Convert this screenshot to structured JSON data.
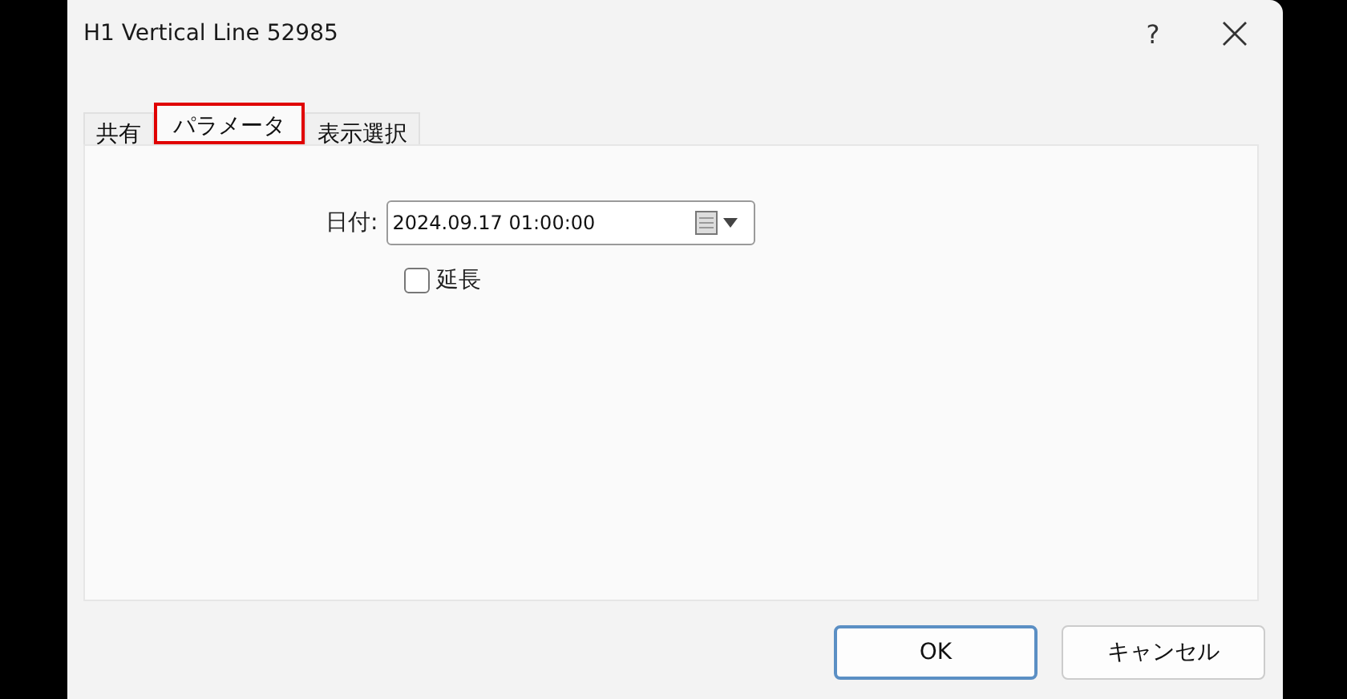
{
  "window": {
    "title": "H1 Vertical Line 52985",
    "help": "?"
  },
  "tabs": [
    {
      "label": "共有",
      "selected": false
    },
    {
      "label": "パラメータ",
      "selected": true
    },
    {
      "label": "表示選択",
      "selected": false
    }
  ],
  "date_field": {
    "label": "日付:",
    "value": "2024.09.17 01:00:00"
  },
  "extend_checkbox": {
    "label": "延長",
    "checked": false
  },
  "buttons": [
    {
      "label": "OK",
      "kind": "default"
    },
    {
      "label": "キャンセル",
      "kind": "normal"
    }
  ]
}
